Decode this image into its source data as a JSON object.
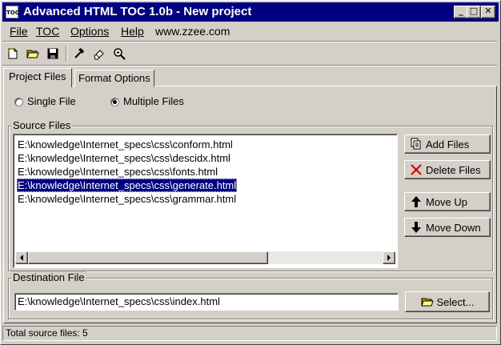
{
  "window": {
    "app_icon_text": "TOC",
    "title": "Advanced HTML TOC 1.0b - New project",
    "minimize_glyph": "_",
    "maximize_glyph": "□",
    "close_glyph": "✕"
  },
  "menu": {
    "file": "File",
    "toc": "TOC",
    "options": "Options",
    "help": "Help",
    "website": "www.zzee.com"
  },
  "toolbar": {
    "icons": [
      "new-document-icon",
      "open-folder-icon",
      "save-disk-icon",
      "hammer-icon",
      "eraser-icon",
      "magnifier-icon"
    ]
  },
  "tabs": {
    "project_files": "Project Files",
    "format_options": "Format Options"
  },
  "mode": {
    "single_file": "Single File",
    "multiple_files": "Multiple Files",
    "selected": "multiple"
  },
  "source_files": {
    "label": "Source Files",
    "items": [
      "E:\\knowledge\\Internet_specs\\css\\conform.html",
      "E:\\knowledge\\Internet_specs\\css\\descidx.html",
      "E:\\knowledge\\Internet_specs\\css\\fonts.html",
      "E:\\knowledge\\Internet_specs\\css\\generate.html",
      "E:\\knowledge\\Internet_specs\\css\\grammar.html"
    ],
    "selected_index": 3
  },
  "buttons": {
    "add_files": "Add Files",
    "delete_files": "Delete Files",
    "move_up": "Move Up",
    "move_down": "Move Down",
    "select": "Select..."
  },
  "destination": {
    "label": "Destination File",
    "value": "E:\\knowledge\\Internet_specs\\css\\index.html"
  },
  "status": {
    "text": "Total source files: 5"
  },
  "colors": {
    "titlebar": "#000080",
    "face": "#d4d0c8",
    "selection": "#000080",
    "delete_icon": "#cc0000"
  }
}
